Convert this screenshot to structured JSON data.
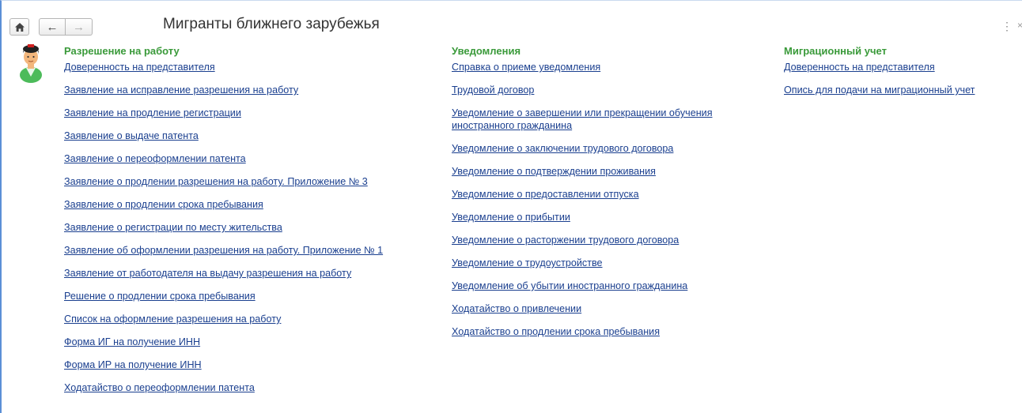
{
  "window": {
    "title": "Мигранты ближнего зарубежья",
    "home_icon": "home-icon",
    "back_icon": "←",
    "forward_icon": "→",
    "more_icon": "⋮",
    "close_icon": "×"
  },
  "columns": [
    {
      "heading": "Разрешение на работу",
      "links": [
        "Доверенность на представителя",
        "Заявление на исправление разрешения на работу",
        "Заявление на продление регистрации",
        "Заявление о выдаче патента",
        "Заявление о переоформлении патента",
        "Заявление о продлении разрешения на работу. Приложение № 3",
        "Заявление о продлении срока пребывания",
        "Заявление о регистрации по месту жительства",
        "Заявление об оформлении разрешения на работу. Приложение № 1",
        "Заявление от работодателя на выдачу разрешения на работу",
        "Решение о продлении срока пребывания",
        "Список на оформление разрешения на работу",
        "Форма ИГ на получение ИНН",
        "Форма ИР на получение ИНН",
        "Ходатайство о переоформлении патента"
      ]
    },
    {
      "heading": "Уведомления",
      "links": [
        "Справка о приеме уведомления",
        "Трудовой договор",
        "Уведомление о завершении или прекращении обучения иностранного гражданина",
        "Уведомление о заключении трудового договора",
        "Уведомление о подтверждении проживания",
        "Уведомление о предоставлении отпуска",
        "Уведомление о прибытии",
        "Уведомление о расторжении трудового договора",
        "Уведомление о трудоустройстве",
        "Уведомление об убытии иностранного гражданина",
        "Ходатайство о привлечении",
        "Ходатайство о продлении срока пребывания"
      ]
    },
    {
      "heading": "Миграционный учет",
      "links": [
        "Доверенность на представителя",
        "Опись для подачи на миграционный учет"
      ]
    }
  ],
  "colors": {
    "heading": "#3a9a3a",
    "link": "#1a3f8f",
    "accent_border": "#5b8fd6"
  }
}
